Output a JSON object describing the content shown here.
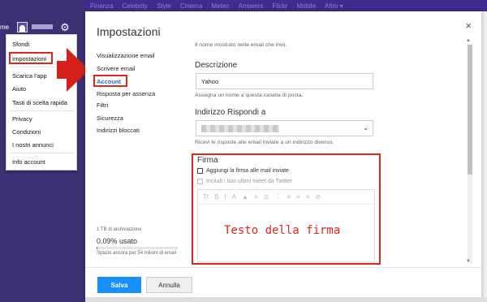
{
  "topbar": {
    "items": [
      "Finanza",
      "Celebrity",
      "Style",
      "Cinema",
      "Meteo",
      "Answers",
      "Flickr",
      "Mobile",
      "Altro ▾"
    ]
  },
  "user": {
    "home_partial": "me"
  },
  "menu": {
    "items": [
      "Sfondi",
      "Impostazioni",
      "Scarica l'app",
      "Aiuto",
      "Tasti di scelta rapida",
      "Privacy",
      "Condizioni",
      "I nostri annunci",
      "Info account"
    ]
  },
  "modal": {
    "title": "Impostazioni",
    "close": "×",
    "nav": [
      "Visualizzazione email",
      "Scrivere email",
      "Account",
      "Risposta per assenza",
      "Filtri",
      "Sicurezza",
      "Indirizzi bloccati"
    ],
    "storage": {
      "total": "1 TB di archiviazione",
      "used": "0.09% usato",
      "note": "Spazio ancora per 54 milioni di email",
      "fraction": 0.0009
    },
    "top_hint": "Il nome mostrato nelle email che invii.",
    "descrizione": {
      "label": "Descrizione",
      "value": "Yahoo",
      "hint": "Assegna un nome a questa casella di posta."
    },
    "reply": {
      "label": "Indirizzo Rispondi a",
      "hint": "Ricevi le risposte alle email inviate a un indirizzo diverso."
    },
    "firma": {
      "label": "Firma",
      "check1": "Aggiungi la firma alle mail inviate",
      "check2": "Includi i tuoi ultimi tweet da Twitter",
      "toolbar": [
        "Tt",
        "B",
        "I",
        "A",
        "▲",
        "≡",
        "≣",
        "⋮",
        "≡",
        "≡",
        "≡",
        "⊘"
      ],
      "text": "Testo della firma"
    },
    "buttons": {
      "save": "Salva",
      "cancel": "Annulla"
    }
  },
  "colors": {
    "accent": "#188fff",
    "highlight": "#e0261d",
    "sidebar": "#3c3175"
  }
}
